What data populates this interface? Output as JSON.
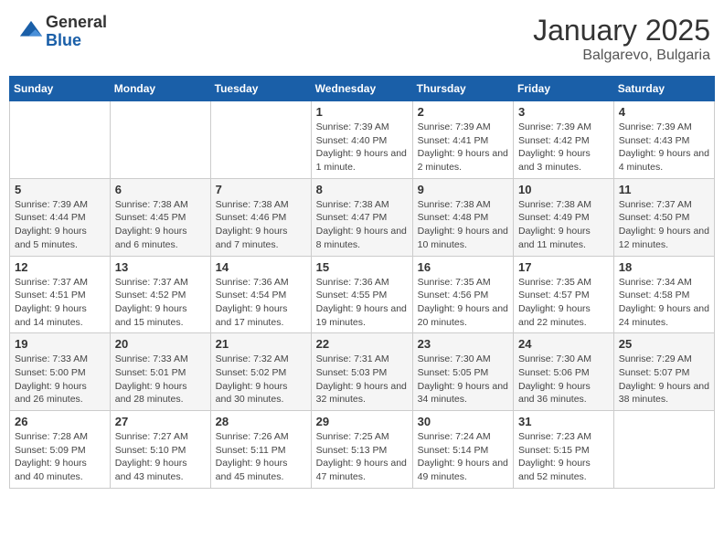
{
  "logo": {
    "general": "General",
    "blue": "Blue"
  },
  "header": {
    "month": "January 2025",
    "location": "Balgarevo, Bulgaria"
  },
  "weekdays": [
    "Sunday",
    "Monday",
    "Tuesday",
    "Wednesday",
    "Thursday",
    "Friday",
    "Saturday"
  ],
  "weeks": [
    [
      {
        "day": "",
        "info": ""
      },
      {
        "day": "",
        "info": ""
      },
      {
        "day": "",
        "info": ""
      },
      {
        "day": "1",
        "info": "Sunrise: 7:39 AM\nSunset: 4:40 PM\nDaylight: 9 hours and 1 minute."
      },
      {
        "day": "2",
        "info": "Sunrise: 7:39 AM\nSunset: 4:41 PM\nDaylight: 9 hours and 2 minutes."
      },
      {
        "day": "3",
        "info": "Sunrise: 7:39 AM\nSunset: 4:42 PM\nDaylight: 9 hours and 3 minutes."
      },
      {
        "day": "4",
        "info": "Sunrise: 7:39 AM\nSunset: 4:43 PM\nDaylight: 9 hours and 4 minutes."
      }
    ],
    [
      {
        "day": "5",
        "info": "Sunrise: 7:39 AM\nSunset: 4:44 PM\nDaylight: 9 hours and 5 minutes."
      },
      {
        "day": "6",
        "info": "Sunrise: 7:38 AM\nSunset: 4:45 PM\nDaylight: 9 hours and 6 minutes."
      },
      {
        "day": "7",
        "info": "Sunrise: 7:38 AM\nSunset: 4:46 PM\nDaylight: 9 hours and 7 minutes."
      },
      {
        "day": "8",
        "info": "Sunrise: 7:38 AM\nSunset: 4:47 PM\nDaylight: 9 hours and 8 minutes."
      },
      {
        "day": "9",
        "info": "Sunrise: 7:38 AM\nSunset: 4:48 PM\nDaylight: 9 hours and 10 minutes."
      },
      {
        "day": "10",
        "info": "Sunrise: 7:38 AM\nSunset: 4:49 PM\nDaylight: 9 hours and 11 minutes."
      },
      {
        "day": "11",
        "info": "Sunrise: 7:37 AM\nSunset: 4:50 PM\nDaylight: 9 hours and 12 minutes."
      }
    ],
    [
      {
        "day": "12",
        "info": "Sunrise: 7:37 AM\nSunset: 4:51 PM\nDaylight: 9 hours and 14 minutes."
      },
      {
        "day": "13",
        "info": "Sunrise: 7:37 AM\nSunset: 4:52 PM\nDaylight: 9 hours and 15 minutes."
      },
      {
        "day": "14",
        "info": "Sunrise: 7:36 AM\nSunset: 4:54 PM\nDaylight: 9 hours and 17 minutes."
      },
      {
        "day": "15",
        "info": "Sunrise: 7:36 AM\nSunset: 4:55 PM\nDaylight: 9 hours and 19 minutes."
      },
      {
        "day": "16",
        "info": "Sunrise: 7:35 AM\nSunset: 4:56 PM\nDaylight: 9 hours and 20 minutes."
      },
      {
        "day": "17",
        "info": "Sunrise: 7:35 AM\nSunset: 4:57 PM\nDaylight: 9 hours and 22 minutes."
      },
      {
        "day": "18",
        "info": "Sunrise: 7:34 AM\nSunset: 4:58 PM\nDaylight: 9 hours and 24 minutes."
      }
    ],
    [
      {
        "day": "19",
        "info": "Sunrise: 7:33 AM\nSunset: 5:00 PM\nDaylight: 9 hours and 26 minutes."
      },
      {
        "day": "20",
        "info": "Sunrise: 7:33 AM\nSunset: 5:01 PM\nDaylight: 9 hours and 28 minutes."
      },
      {
        "day": "21",
        "info": "Sunrise: 7:32 AM\nSunset: 5:02 PM\nDaylight: 9 hours and 30 minutes."
      },
      {
        "day": "22",
        "info": "Sunrise: 7:31 AM\nSunset: 5:03 PM\nDaylight: 9 hours and 32 minutes."
      },
      {
        "day": "23",
        "info": "Sunrise: 7:30 AM\nSunset: 5:05 PM\nDaylight: 9 hours and 34 minutes."
      },
      {
        "day": "24",
        "info": "Sunrise: 7:30 AM\nSunset: 5:06 PM\nDaylight: 9 hours and 36 minutes."
      },
      {
        "day": "25",
        "info": "Sunrise: 7:29 AM\nSunset: 5:07 PM\nDaylight: 9 hours and 38 minutes."
      }
    ],
    [
      {
        "day": "26",
        "info": "Sunrise: 7:28 AM\nSunset: 5:09 PM\nDaylight: 9 hours and 40 minutes."
      },
      {
        "day": "27",
        "info": "Sunrise: 7:27 AM\nSunset: 5:10 PM\nDaylight: 9 hours and 43 minutes."
      },
      {
        "day": "28",
        "info": "Sunrise: 7:26 AM\nSunset: 5:11 PM\nDaylight: 9 hours and 45 minutes."
      },
      {
        "day": "29",
        "info": "Sunrise: 7:25 AM\nSunset: 5:13 PM\nDaylight: 9 hours and 47 minutes."
      },
      {
        "day": "30",
        "info": "Sunrise: 7:24 AM\nSunset: 5:14 PM\nDaylight: 9 hours and 49 minutes."
      },
      {
        "day": "31",
        "info": "Sunrise: 7:23 AM\nSunset: 5:15 PM\nDaylight: 9 hours and 52 minutes."
      },
      {
        "day": "",
        "info": ""
      }
    ]
  ]
}
